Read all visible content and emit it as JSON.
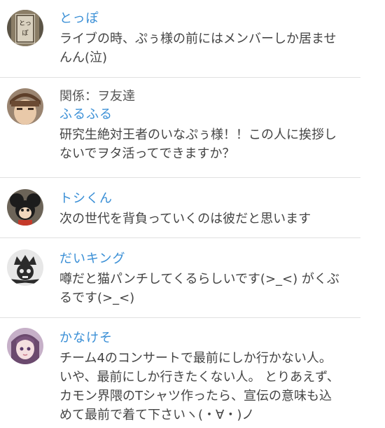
{
  "comments": [
    {
      "username": "とっぽ",
      "text": "ライブの時、ぷぅ様の前にはメンバーしか居ませんん(泣)",
      "avatar_icon": "nameplate-photo-avatar-icon"
    },
    {
      "relation": "関係：ヲ友達",
      "username": "ふるふる",
      "text": "研究生絶対王者のいなぷぅ様！！この人に挨拶しないでヲタ活ってできますか？",
      "avatar_icon": "person-photo-avatar-icon"
    },
    {
      "username": "トシくん",
      "text": "次の世代を背負っていくのは彼だと思います",
      "avatar_icon": "cartoon-mouse-avatar-icon"
    },
    {
      "username": "だいキング",
      "text": "噂だと猫パンチしてくるらしいです(>_<) がくぶるです(>_<)",
      "avatar_icon": "crown-skull-avatar-icon"
    },
    {
      "username": "かなけそ",
      "text": "チーム4のコンサートで最前にしか行かない人。いや、最前にしか行きたくない人。 とりあえず、カモン界隈のTシャツ作ったら、宣伝の意味も込めて最前で着て下さいヽ(・∀・)ノ",
      "avatar_icon": "anime-girl-avatar-icon"
    }
  ],
  "colors": {
    "username": "#3a8fd6",
    "text": "#444444",
    "divider": "#e1e1e1"
  }
}
